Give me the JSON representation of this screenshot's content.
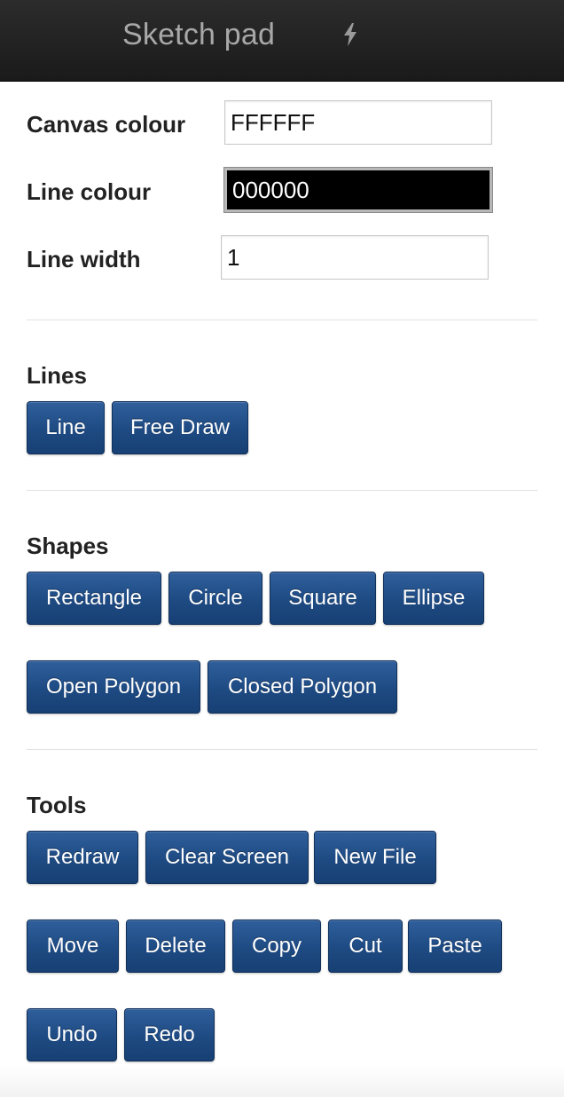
{
  "navbar": {
    "title": "Sketch pad",
    "icon": "bolt-icon"
  },
  "settings": {
    "canvas_colour": {
      "label": "Canvas colour",
      "value": "FFFFFF",
      "color": "#FFFFFF"
    },
    "line_colour": {
      "label": "Line colour",
      "value": "000000",
      "color": "#000000"
    },
    "line_width": {
      "label": "Line width",
      "value": "1"
    }
  },
  "sections": {
    "lines": {
      "title": "Lines",
      "buttons": [
        "Line",
        "Free Draw"
      ]
    },
    "shapes": {
      "title": "Shapes",
      "buttons": [
        "Rectangle",
        "Circle",
        "Square",
        "Ellipse",
        "Open Polygon",
        "Closed Polygon"
      ]
    },
    "tools": {
      "title": "Tools",
      "buttons": [
        "Redraw",
        "Clear Screen",
        "New File",
        "Move",
        "Delete",
        "Copy",
        "Cut",
        "Paste",
        "Undo",
        "Redo"
      ]
    }
  },
  "colors": {
    "navbar_bg": "#1f1f1f",
    "button_bg": "#1e4a82",
    "button_text": "#ffffff"
  }
}
